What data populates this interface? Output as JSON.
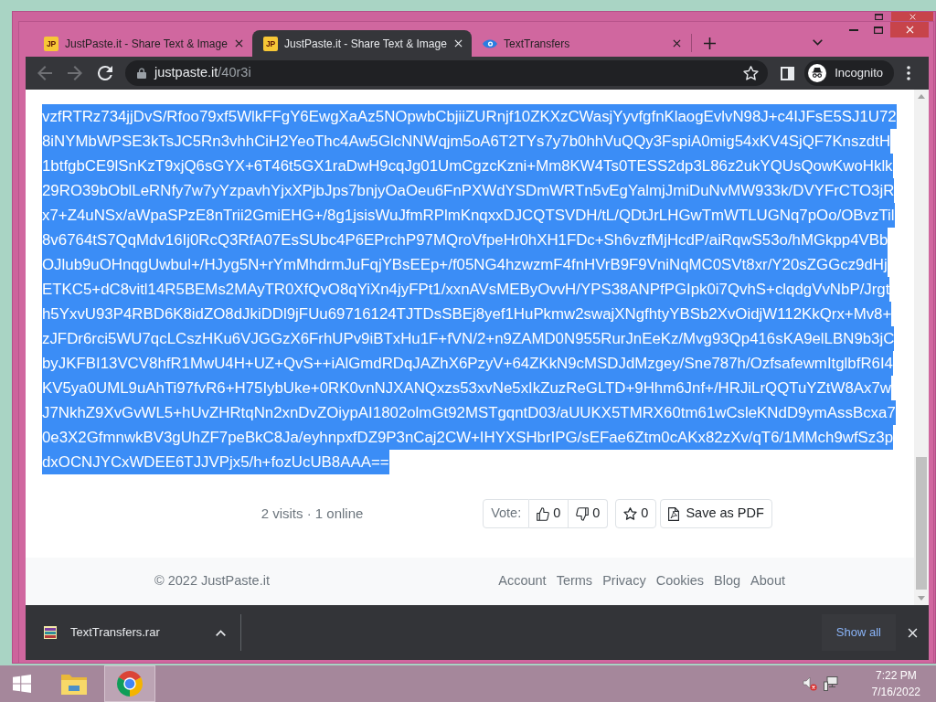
{
  "browser": {
    "tabs": [
      {
        "title": "JustPaste.it - Share Text & Image",
        "favicon_text": "JP",
        "kind": "monogram",
        "selected": false
      },
      {
        "title": "JustPaste.it - Share Text & Image",
        "favicon_text": "JP",
        "kind": "monogram",
        "selected": true
      },
      {
        "title": "TextTransfers",
        "kind": "logo",
        "selected": false
      }
    ],
    "nav": [
      {
        "kind": "back",
        "disabled": true
      },
      {
        "kind": "forward",
        "disabled": true
      },
      {
        "kind": "reload",
        "disabled": false
      }
    ],
    "address": {
      "host": "justpaste.it",
      "path": "/40r3i"
    },
    "profile": {
      "label": "Incognito"
    }
  },
  "paste": {
    "selected": true,
    "lines": [
      "vzfRTRz734jjDvS/Rfoo79xf5WlkFFgY6EwgXaAz5NOpwbCbjiiZURnjf10ZKXzCWasjYyvfgfnKlaogEvlvN98J+c4IJFsE5SJ1U72",
      "8iNYMbWPSE3kTsJC5Rn3vhhCiH2YeoThc4Aw5GlcNNWqjm5oA6T2TYs7y7b0hhVuQQy3FspiA0mig54xKV4SjQF7KnszdtH",
      "1btfgbCE9lSnKzT9xjQ6sGYX+6T46t5GX1raDwH9cqJg01UmCgzcKzni+Mm8KW4Ts0TESS2dp3L86z2ukYQUsQowKwoHklk",
      "29RO39bOblLeRNfy7w7yYzpavhYjxXPjbJps7bnjyOaOeu6FnPXWdYSDmWRTn5vEgYalmjJmiDuNvMW933k/DVYFrCTO3jR",
      "x7+Z4uNSx/aWpaSPzE8nTrii2GmiEHG+/8g1jsisWuJfmRPlmKnqxxDJCQTSVDH/tL/QDtJrLHGwTmWTLUGNq7pOo/OBvzTil",
      "8v6764tS7QqMdv16Ij0RcQ3RfA07EsSUbc4P6EPrchP97MQroVfpeHr0hXH1FDc+Sh6vzfMjHcdP/aiRqwS53o/hMGkpp4VBb",
      "OJlub9uOHnqgUwbul+/HJyg5N+rYmMhdrmJuFqjYBsEEp+/f05NG4hzwzmF4fnHVrB9F9VniNqMC0SVt8xr/Y20sZGGcz9dHj",
      "ETKC5+dC8vitl14R5BEMs2MAyTR0XfQvO8qYiXn4jyFPt1/xxnAVsMEByOvvH/YPS38ANPfPGIpk0i7QvhS+clqdgVvNbP/Jrgt",
      "h5YxvU93P4RBD6K8idZO8dJkiDDl9jFUu69716124TJTDsSBEj8yef1HuPkmw2swajXNgfhtyYBSb2XvOidjW112KkQrx+Mv8+",
      "zJFDr6rci5WU7qcLCszHKu6VJGGzX6FrhUPv9iBTxHu1F+fVN/2+n9ZAMD0N955RurJnEeKz/Mvg93Qp416sKA9elLBN9b3jC",
      "byJKFBI13VCV8hfR1MwU4H+UZ+QvS++iAlGmdRDqJAZhX6PzyV+64ZKkN9cMSDJdMzgey/Sne787h/OzfsafewmItglbfR6I4",
      "KV5ya0UML9uAhTi97fvR6+H75IybUke+0RK0vnNJXANQxzs53xvNe5xIkZuzReGLTD+9Hhm6Jnf+/HRJiLrQQTuYZtW8Ax7w",
      "J7NkhZ9XvGvWL5+hUvZHRtqNn2xnDvZOiypAI1802olmGt92MSTgqntD03/aUUKX5TMRX60tm61wCsleKNdD9ymAssBcxa7",
      "0e3X2GfmnwkBV3gUhZF7peBkC8Ja/eyhnpxfDZ9P3nCaj2CW+IHYXSHbrIPG/sEFae6Ztm0cAKx82zXv/qT6/1MMch9wfSz3p",
      "dxOCNJYCxWDEE6TJJVPjx5/h+fozUcUB8AAA=="
    ]
  },
  "stats": "2 visits · 1 online",
  "vote": {
    "label": "Vote:",
    "up": "0",
    "down": "0",
    "favorites": "0",
    "save_pdf": "Save as PDF"
  },
  "footer": {
    "copyright": "© 2022 JustPaste.it",
    "links": [
      "Account",
      "Terms",
      "Privacy",
      "Cookies",
      "Blog",
      "About"
    ]
  },
  "downloads": {
    "items": [
      {
        "file": "TextTransfers.rar"
      }
    ],
    "show_all": "Show all"
  },
  "taskbar": {
    "apps": [
      {
        "kind": "explorer",
        "selected": false
      },
      {
        "kind": "browser",
        "selected": true
      }
    ],
    "time": "7:22 PM",
    "date": "7/16/2022"
  }
}
